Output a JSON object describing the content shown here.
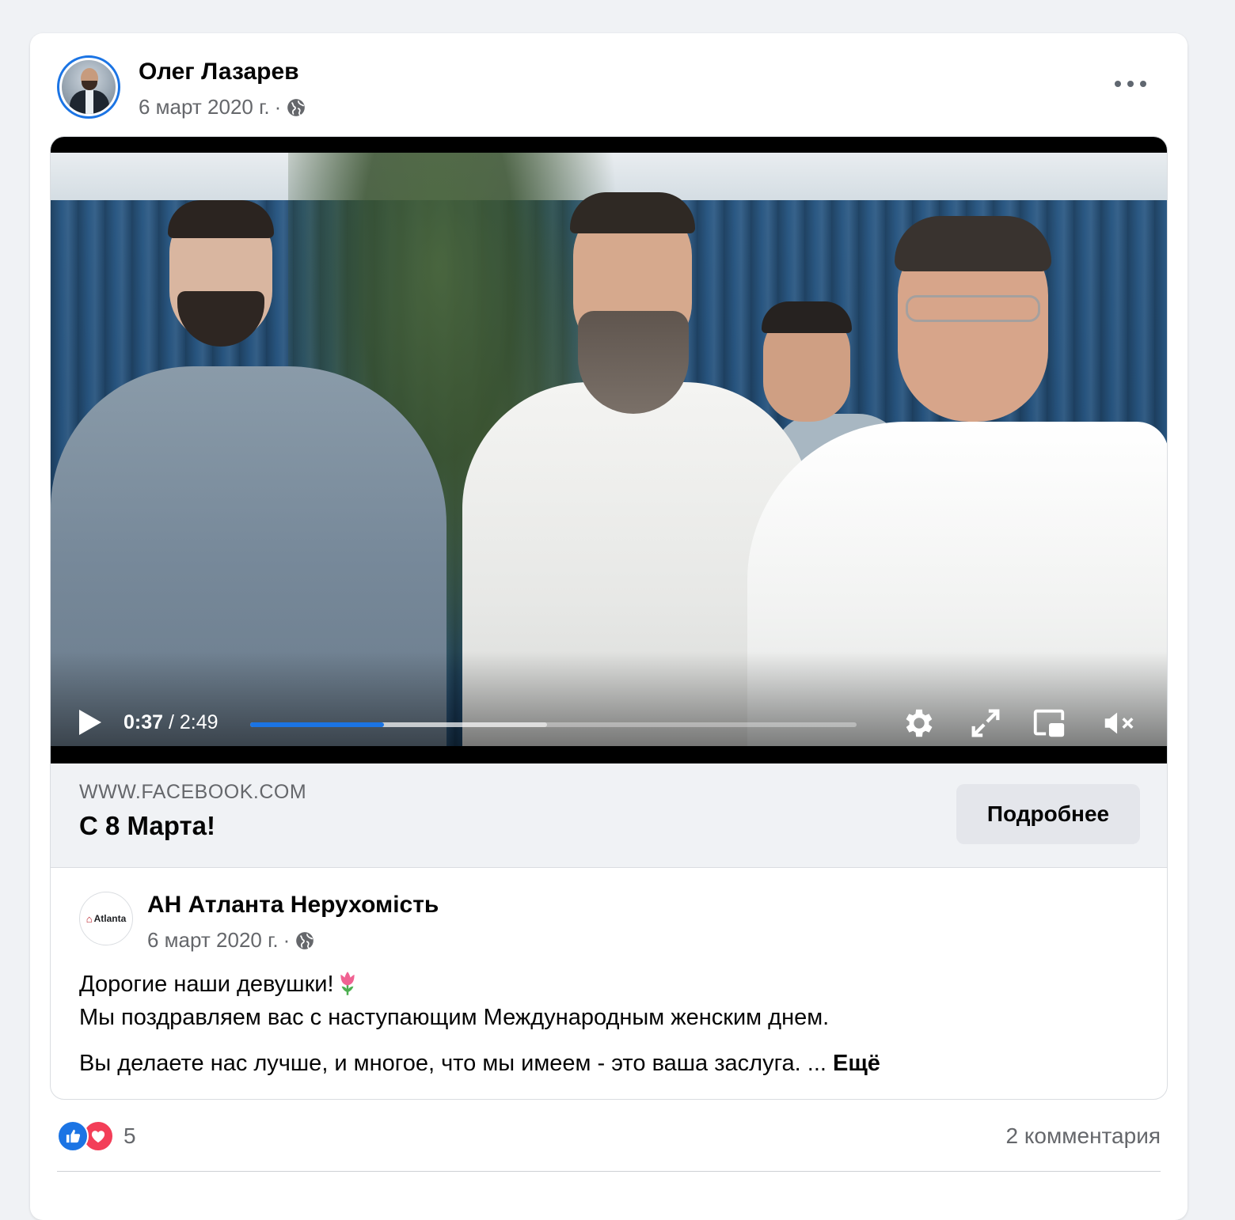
{
  "post": {
    "author": "Олег Лазарев",
    "date": "6 март 2020 г.",
    "separator": "·",
    "privacy_icon": "globe-icon",
    "more_icon": "more-horizontal-icon"
  },
  "video": {
    "current_time": "0:37",
    "separator": "/",
    "duration": "2:49",
    "played_fraction": 0.22,
    "buffered_fraction": 0.49,
    "icons": [
      "play-icon",
      "settings-icon",
      "fullscreen-icon",
      "picture-in-picture-icon",
      "muted-volume-icon"
    ]
  },
  "link": {
    "domain": "WWW.FACEBOOK.COM",
    "title": "С 8 Марта!",
    "button_label": "Подробнее"
  },
  "shared_post": {
    "page_name": "АН Атланта Нерухомість",
    "avatar_text": "Atlanta",
    "date": "6 март 2020 г.",
    "separator": "·",
    "line1": "Дорогие наши девушки!",
    "line2": "Мы поздравляем вас с наступающим Международным женским днем.",
    "line3": "Вы делаете нас лучше, и многое, что мы имеем - это ваша заслуга. ...",
    "see_more": "Ещё"
  },
  "footer": {
    "reaction_icons": [
      "like-reaction-icon",
      "love-reaction-icon"
    ],
    "reaction_count": "5",
    "comments": "2 комментария"
  },
  "colors": {
    "accent": "#1b74e4",
    "love": "#f33e58",
    "secondary_text": "#65676b",
    "page_bg": "#f0f2f5"
  }
}
